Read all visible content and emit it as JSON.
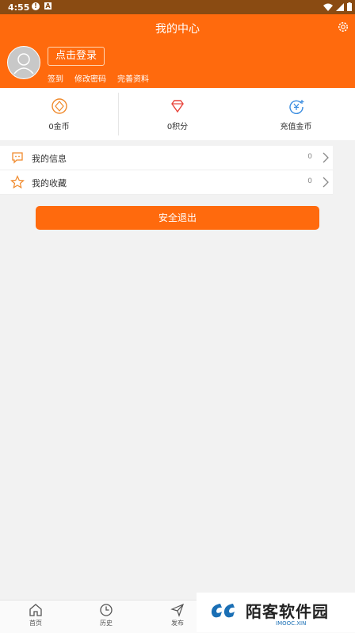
{
  "statusbar": {
    "time": "4:55",
    "icon1": "!",
    "icon2": "A"
  },
  "titlebar": {
    "title": "我的中心",
    "settings_icon": "gear-icon"
  },
  "profile": {
    "login_label": "点击登录",
    "links": [
      "签到",
      "修改密码",
      "完善资料"
    ]
  },
  "stats": [
    {
      "label": "0金币",
      "icon": "coin-icon"
    },
    {
      "label": "0积分",
      "icon": "diamond-icon"
    },
    {
      "label": "充值金币",
      "icon": "recharge-icon"
    }
  ],
  "menu": [
    {
      "label": "我的信息",
      "count": "0",
      "icon": "message-icon"
    },
    {
      "label": "我的收藏",
      "count": "0",
      "icon": "star-icon"
    }
  ],
  "logout_label": "安全退出",
  "tabs": [
    {
      "label": "首页",
      "icon": "home-icon"
    },
    {
      "label": "历史",
      "icon": "clock-icon"
    },
    {
      "label": "发布",
      "icon": "send-icon"
    }
  ],
  "watermark": {
    "text": "陌客软件园",
    "sub": "IMOOC.XIN"
  },
  "colors": {
    "primary": "#ff6a0d",
    "status_bar": "#8a4b12",
    "background": "#f2f2f2"
  }
}
